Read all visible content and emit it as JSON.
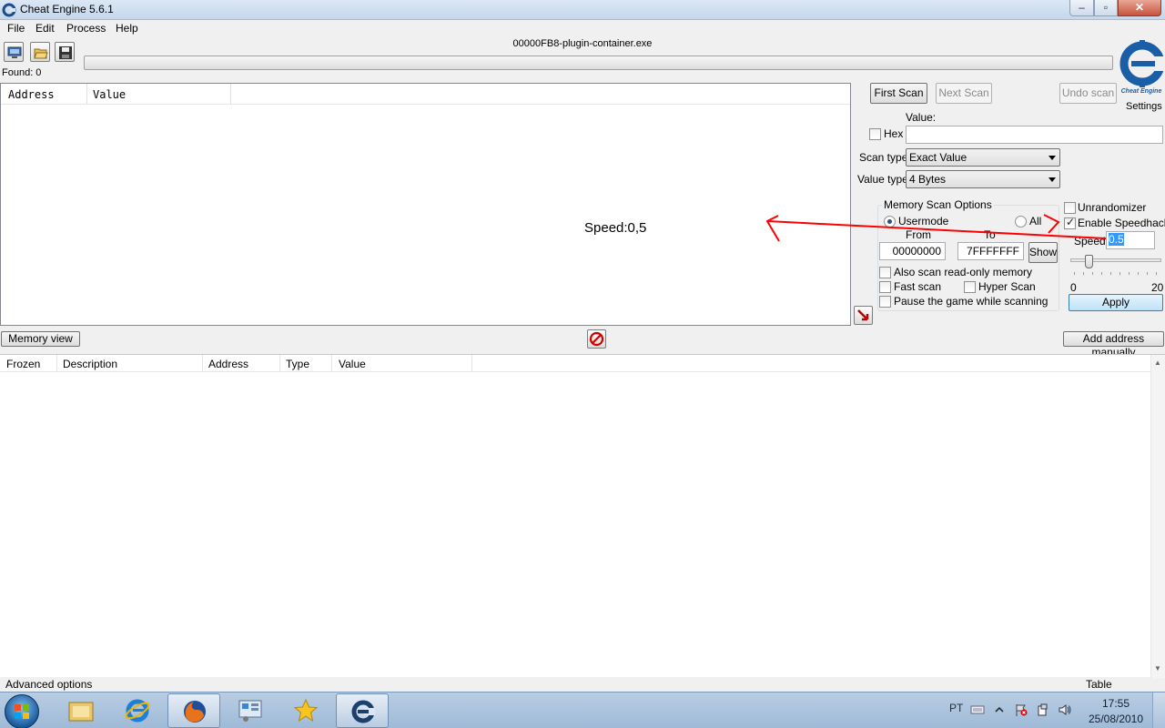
{
  "window": {
    "title": "Cheat Engine 5.6.1",
    "minimize": "–",
    "maximize": "▫",
    "close": "✕"
  },
  "menu": [
    "File",
    "Edit",
    "Process",
    "Help"
  ],
  "toolbar": {
    "process_name": "00000FB8-plugin-container.exe",
    "found": "Found: 0",
    "settings": "Settings"
  },
  "results": {
    "columns": [
      "Address",
      "Value"
    ]
  },
  "annotation": {
    "note": "Speed:0,5",
    "color": "#ff0000"
  },
  "scan": {
    "first_scan": "First Scan",
    "next_scan": "Next Scan",
    "undo_scan": "Undo scan",
    "value_label": "Value:",
    "value": "",
    "hex_label": "Hex",
    "scan_type_label": "Scan type",
    "scan_type": "Exact Value",
    "value_type_label": "Value type",
    "value_type": "4 Bytes",
    "memory_options_title": "Memory Scan Options",
    "usermode": "Usermode",
    "all": "All",
    "from_label": "From",
    "to_label": "To",
    "from": "00000000",
    "to": "7FFFFFFF",
    "show": "Show",
    "readonly": "Also scan read-only memory",
    "fast_scan": "Fast scan",
    "hyper_scan": "Hyper Scan",
    "pause_game": "Pause the game while scanning"
  },
  "speedhack": {
    "unrandomizer": "Unrandomizer",
    "enable": "Enable Speedhack",
    "enabled": true,
    "speed_label": "Speed",
    "speed": "0.5",
    "slider_min": "0",
    "slider_max": "20",
    "slider_value": 0.5,
    "apply": "Apply"
  },
  "middle": {
    "memory_view": "Memory view",
    "add_address": "Add address manually"
  },
  "address_table": {
    "columns": [
      "Frozen",
      "Description",
      "Address",
      "Type",
      "Value"
    ]
  },
  "footer": {
    "advanced": "Advanced options",
    "comments": "Table Comments"
  },
  "taskbar": {
    "language": "PT",
    "time": "17:55",
    "date": "25/08/2010"
  }
}
